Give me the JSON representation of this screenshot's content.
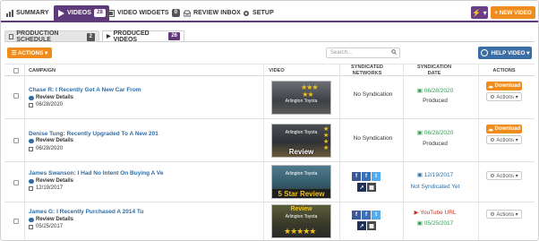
{
  "nav": {
    "summary": "SUMMARY",
    "videos": "VIDEOS",
    "videos_count": "28",
    "widgets": "VIDEO WIDGETS",
    "widgets_count": "0",
    "inbox": "REVIEW INBOX",
    "setup": "SETUP",
    "new_video": "+ NEW VIDEO",
    "bolt": "⚡ ▾"
  },
  "subtabs": {
    "schedule": "PRODUCTION SCHEDULE",
    "schedule_count": "2",
    "produced": "PRODUCED VIDEOS",
    "produced_count": "26"
  },
  "toolbar": {
    "actions": "☰ ACTIONS ▾",
    "search_placeholder": "Search...",
    "help": "HELP VIDEO ▾"
  },
  "columns": {
    "campaign": "CAMPAIGN",
    "video": "VIDEO",
    "networks": "SYNDICATED NETWORKS",
    "date": "SYNDICATION DATE",
    "actions": "ACTIONS"
  },
  "common": {
    "review_details": "Review Details",
    "download": "Download",
    "actions": "Actions ▾",
    "brand": "Arlington Toyota"
  },
  "rows": [
    {
      "title": "Chase R: I Recently Got A New Car From",
      "date": "06/28/2020",
      "networks": "No Syndication",
      "sync_date": "06/28/2020",
      "status": "Produced"
    },
    {
      "title": "Denise Tung: Recently Upgraded To A New 201",
      "date": "06/28/2020",
      "networks": "No Syndication",
      "sync_date": "06/28/2020",
      "status": "Produced",
      "overlay": "Review"
    },
    {
      "title": "James Swanson: I Had No Intent On Buying A Ve",
      "date": "12/19/2017",
      "sync_date": "12/19/2017",
      "status": "Not Syndicated Yet",
      "overlay": "5 Star Review"
    },
    {
      "title": "James G: I Recently Purchased A 2014 Tu",
      "date": "05/25/2017",
      "youtube": "YouTube URL",
      "sync_date": "05/25/2017",
      "overlay": "Review"
    }
  ],
  "colors": {
    "purple": "#5e3a7a",
    "orange": "#f08c1e",
    "link": "#2f6da3",
    "green": "#2e9e4e"
  }
}
